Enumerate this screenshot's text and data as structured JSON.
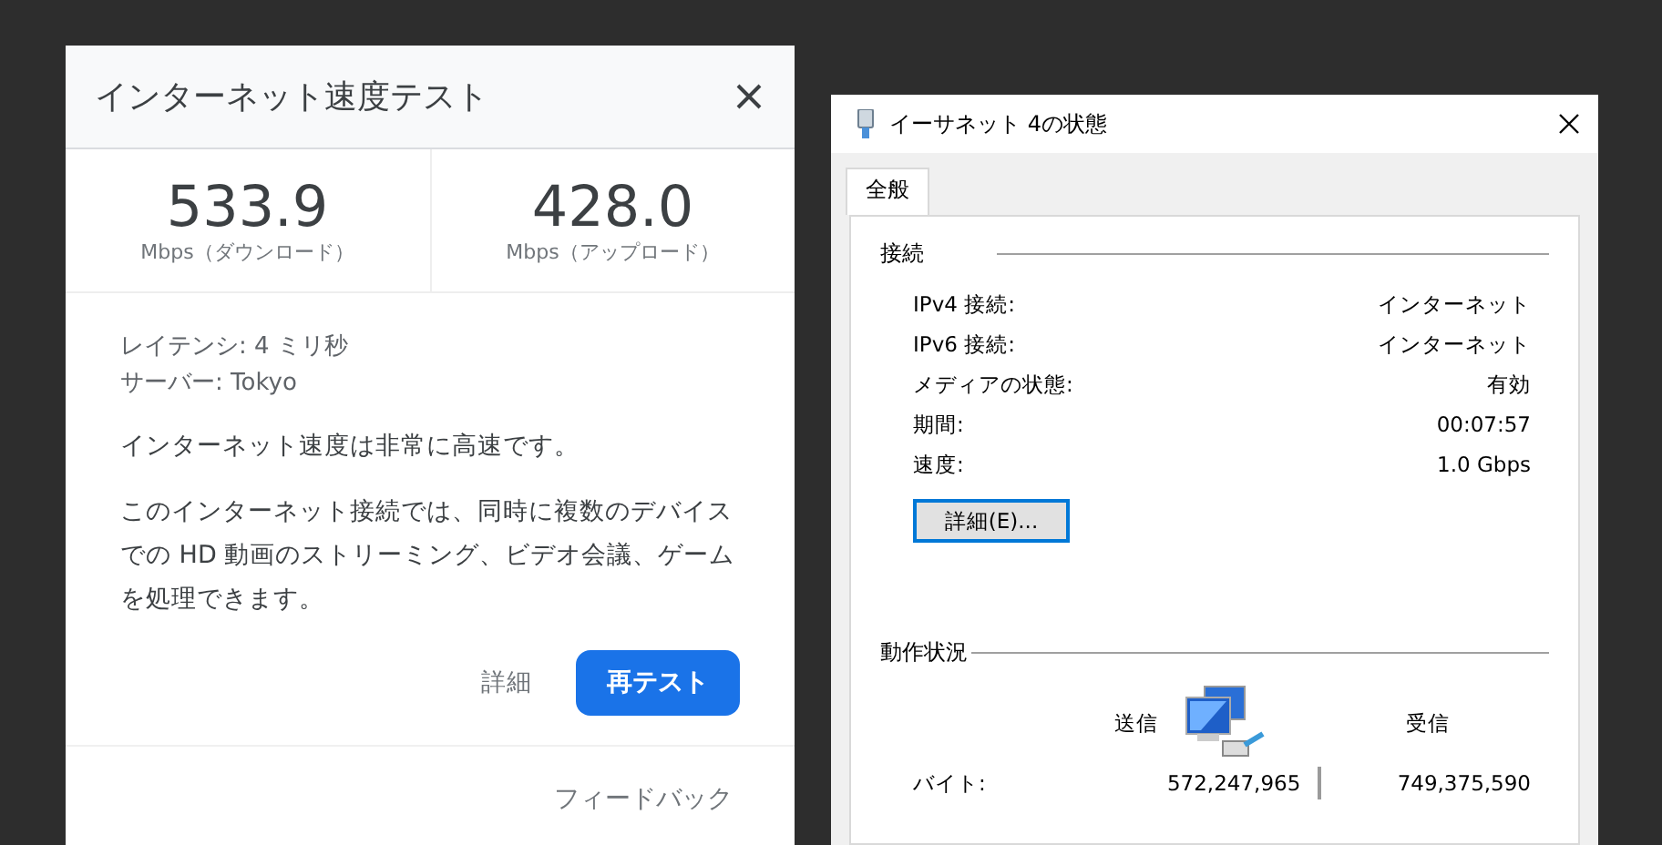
{
  "speed_test": {
    "title": "インターネット速度テスト",
    "results": [
      {
        "value": "533.9",
        "unit": "Mbps（ダウンロード）"
      },
      {
        "value": "428.0",
        "unit": "Mbps（アップロード）"
      }
    ],
    "details": [
      "レイテンシ: 4 ミリ秒",
      "サーバー: Tokyo"
    ],
    "summary": "インターネット速度は非常に高速です。",
    "description": "このインターネット接続では、同時に複数のデバイスでの HD 動画のストリーミング、ビデオ会議、ゲームを処理できます。",
    "buttons": [
      {
        "label": "詳細",
        "kind": "text"
      },
      {
        "label": "再テスト",
        "kind": "primary"
      }
    ],
    "feedback": "フィードバック"
  },
  "status_window": {
    "title": "イーサネット 4の状態",
    "tabs": [
      {
        "label": "全般",
        "selected": true
      }
    ],
    "connection": {
      "title": "接続",
      "rows": [
        {
          "label": "IPv4 接続:",
          "value": "インターネット"
        },
        {
          "label": "IPv6 接続:",
          "value": "インターネット"
        },
        {
          "label": "メディアの状態:",
          "value": "有効"
        },
        {
          "label": "期間:",
          "value": "00:07:57"
        },
        {
          "label": "速度:",
          "value": "1.0 Gbps"
        }
      ],
      "button": "詳細(E)..."
    },
    "activity": {
      "title": "動作状況",
      "sent_label": "送信",
      "received_label": "受信",
      "rows": [
        {
          "label": "バイト:",
          "sent": "572,247,965",
          "received": "749,375,590"
        }
      ]
    }
  }
}
